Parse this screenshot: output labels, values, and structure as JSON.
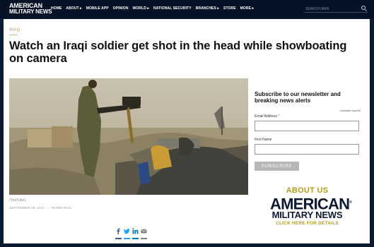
{
  "header": {
    "logo_line1": "AMERICAN",
    "logo_line2": "MILITARY NEWS",
    "nav": [
      "HOME",
      "ABOUT ▸",
      "MOBILE APP",
      "OPINION",
      "WORLD ▸",
      "NATIONAL SECURITY",
      "BRANCHES ▸",
      "STORE",
      "MORE ▸"
    ],
    "search_placeholder": "SEARCH AMN"
  },
  "article": {
    "category": "IRAQ",
    "title": "Watch an Iraqi soldier get shot in the head while showboating on camera",
    "caption": "(YouTube)",
    "date": "SEPTEMBER 28, 2017",
    "author": "PETER RICE"
  },
  "share": {
    "icons": [
      "facebook-icon",
      "twitter-icon",
      "linkedin-icon",
      "email-icon"
    ],
    "colors": [
      "#3b5998",
      "#1da1f2",
      "#0077b5",
      "#7f7f7f"
    ]
  },
  "newsletter": {
    "title": "Subscribe to our newsletter and breaking news alerts",
    "required_note": "• indicates required",
    "email_label": "Email Address",
    "required_mark": "*",
    "first_name_label": "First Name",
    "subscribe_label": "SUBSCRIBE"
  },
  "ad": {
    "about": "ABOUT US",
    "line1": "AMERICAN",
    "registered": "®",
    "line2": "MILITARY NEWS",
    "cta": "CLICK HERE FOR DETAILS"
  },
  "colors": {
    "navy": "#0b1b33",
    "gold": "#b59a1e",
    "category": "#b9975b"
  }
}
